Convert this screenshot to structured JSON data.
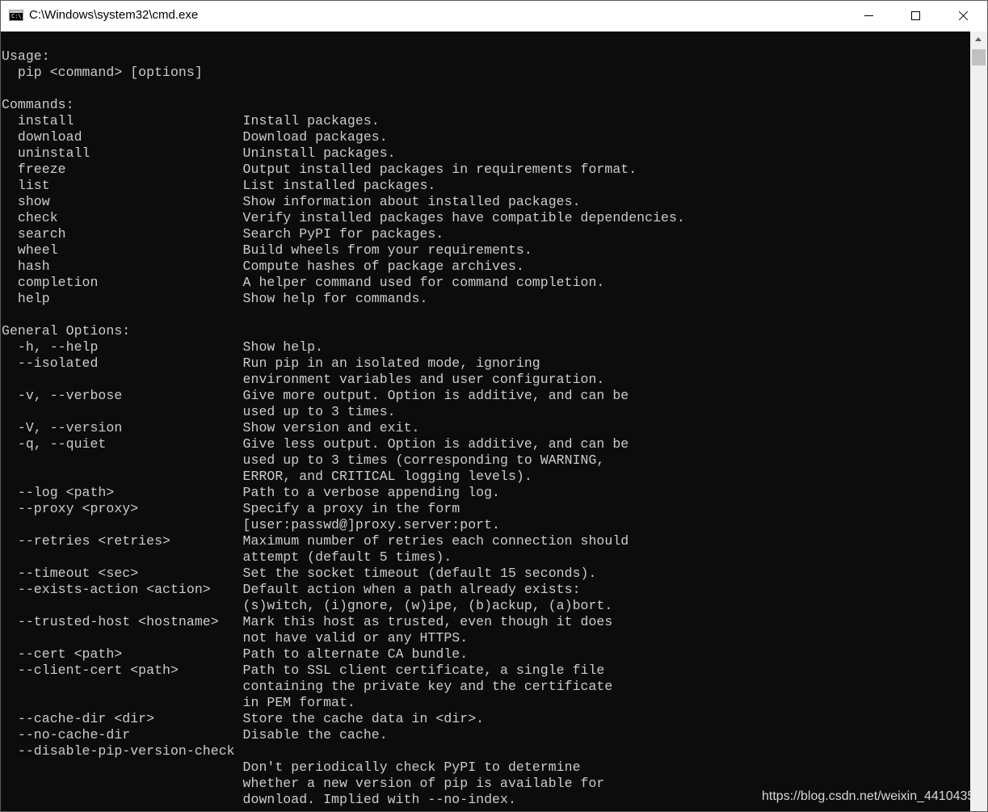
{
  "window": {
    "title": "C:\\Windows\\system32\\cmd.exe",
    "icon_text": "C:\\."
  },
  "console": {
    "lines": [
      "Usage:",
      "  pip <command> [options]",
      "",
      "Commands:",
      "  install                     Install packages.",
      "  download                    Download packages.",
      "  uninstall                   Uninstall packages.",
      "  freeze                      Output installed packages in requirements format.",
      "  list                        List installed packages.",
      "  show                        Show information about installed packages.",
      "  check                       Verify installed packages have compatible dependencies.",
      "  search                      Search PyPI for packages.",
      "  wheel                       Build wheels from your requirements.",
      "  hash                        Compute hashes of package archives.",
      "  completion                  A helper command used for command completion.",
      "  help                        Show help for commands.",
      "",
      "General Options:",
      "  -h, --help                  Show help.",
      "  --isolated                  Run pip in an isolated mode, ignoring",
      "                              environment variables and user configuration.",
      "  -v, --verbose               Give more output. Option is additive, and can be",
      "                              used up to 3 times.",
      "  -V, --version               Show version and exit.",
      "  -q, --quiet                 Give less output. Option is additive, and can be",
      "                              used up to 3 times (corresponding to WARNING,",
      "                              ERROR, and CRITICAL logging levels).",
      "  --log <path>                Path to a verbose appending log.",
      "  --proxy <proxy>             Specify a proxy in the form",
      "                              [user:passwd@]proxy.server:port.",
      "  --retries <retries>         Maximum number of retries each connection should",
      "                              attempt (default 5 times).",
      "  --timeout <sec>             Set the socket timeout (default 15 seconds).",
      "  --exists-action <action>    Default action when a path already exists:",
      "                              (s)witch, (i)gnore, (w)ipe, (b)ackup, (a)bort.",
      "  --trusted-host <hostname>   Mark this host as trusted, even though it does",
      "                              not have valid or any HTTPS.",
      "  --cert <path>               Path to alternate CA bundle.",
      "  --client-cert <path>        Path to SSL client certificate, a single file",
      "                              containing the private key and the certificate",
      "                              in PEM format.",
      "  --cache-dir <dir>           Store the cache data in <dir>.",
      "  --no-cache-dir              Disable the cache.",
      "  --disable-pip-version-check",
      "                              Don't periodically check PyPI to determine",
      "                              whether a new version of pip is available for",
      "                              download. Implied with --no-index."
    ]
  },
  "watermark": "https://blog.csdn.net/weixin_4410435",
  "colors": {
    "console_bg": "#0c0c0c",
    "console_fg": "#cccccc",
    "titlebar_bg": "#ffffff",
    "scrollbar_bg": "#f0f0f0",
    "scroll_thumb": "#c0c0c0"
  }
}
